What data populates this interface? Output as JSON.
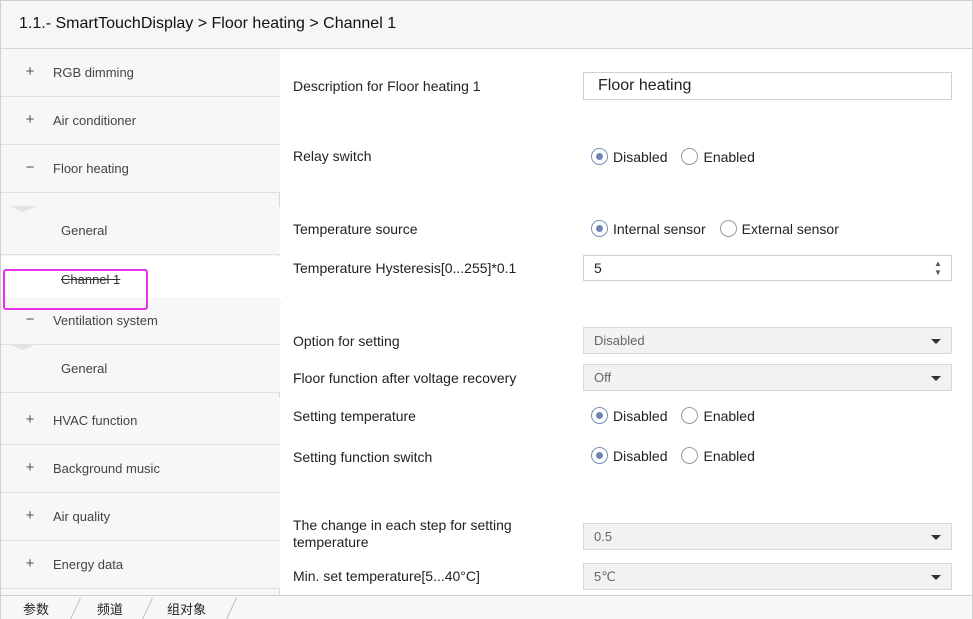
{
  "breadcrumb": "1.1.- SmartTouchDisplay > Floor heating > Channel 1",
  "sidebar": {
    "items": [
      {
        "symbol": "+",
        "label": "RGB dimming"
      },
      {
        "symbol": "+",
        "label": "Air conditioner"
      },
      {
        "symbol": "−",
        "label": "Floor heating"
      },
      {
        "symbol": "",
        "label": "General"
      },
      {
        "symbol": "",
        "label": "Channel 1"
      },
      {
        "symbol": "−",
        "label": "Ventilation system"
      },
      {
        "symbol": "",
        "label": "General"
      },
      {
        "symbol": "+",
        "label": "HVAC function"
      },
      {
        "symbol": "+",
        "label": "Background music"
      },
      {
        "symbol": "+",
        "label": "Air quality"
      },
      {
        "symbol": "+",
        "label": "Energy data"
      }
    ],
    "selected_index": 4
  },
  "form": {
    "description": {
      "label": "Description for Floor heating 1",
      "value": "Floor heating"
    },
    "relay_switch": {
      "label": "Relay switch",
      "options": [
        "Disabled",
        "Enabled"
      ],
      "selected": "Disabled"
    },
    "temperature_source": {
      "label": "Temperature source",
      "options": [
        "Internal sensor",
        "External sensor"
      ],
      "selected": "Internal sensor"
    },
    "hysteresis": {
      "label": "Temperature Hysteresis[0...255]*0.1",
      "value": "5",
      "arrow_up": "▲",
      "arrow_down": "▼"
    },
    "option_for_setting": {
      "label": "Option for setting",
      "value": "Disabled"
    },
    "floor_function": {
      "label": "Floor function after  voltage recovery",
      "value": "Off"
    },
    "setting_temperature": {
      "label": "Setting temperature",
      "options": [
        "Disabled",
        "Enabled"
      ],
      "selected": "Disabled"
    },
    "setting_function_switch": {
      "label": "Setting function switch",
      "options": [
        "Disabled",
        "Enabled"
      ],
      "selected": "Disabled"
    },
    "change_step": {
      "label": "The change in each step for setting temperature",
      "value": "0.5"
    },
    "min_set_temp": {
      "label": "Min. set temperature[5...40°C]",
      "value": "5℃"
    }
  },
  "tabs": [
    "参数",
    "频道",
    "组对象"
  ],
  "colors": {
    "highlight": "#e633e6",
    "radio_dot": "#6d86b2"
  }
}
